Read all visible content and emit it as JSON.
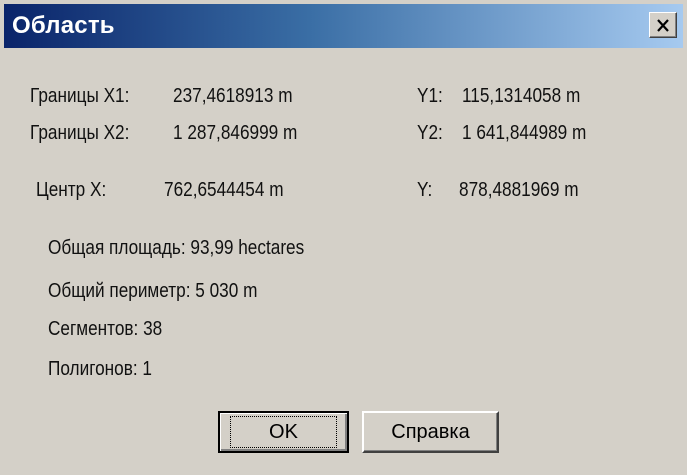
{
  "dialog": {
    "title": "Область"
  },
  "bounds": {
    "x1_label": "Границы X1:",
    "x1_value": "237,4618913 m",
    "y1_label": "Y1:",
    "y1_value": "115,1314058 m",
    "x2_label": "Границы X2:",
    "x2_value": "1 287,846999 m",
    "y2_label": "Y2:",
    "y2_value": "1 641,844989 m"
  },
  "center": {
    "x_label": "Центр X:",
    "x_value": "762,6544454 m",
    "y_label": "Y:",
    "y_value": "878,4881969 m"
  },
  "stats": {
    "area": "Общая площадь:  93,99 hectares",
    "perimeter": "Общий периметр:  5 030 m",
    "segments": "Сегментов:  38",
    "polygons": "Полигонов:  1"
  },
  "buttons": {
    "ok_label": "OK",
    "help_label": "Справка"
  },
  "icons": {
    "close": "close-icon"
  },
  "colors": {
    "titlebar_start": "#0a246a",
    "titlebar_end": "#a6caf0",
    "dialog_bg": "#d4d0c8"
  }
}
